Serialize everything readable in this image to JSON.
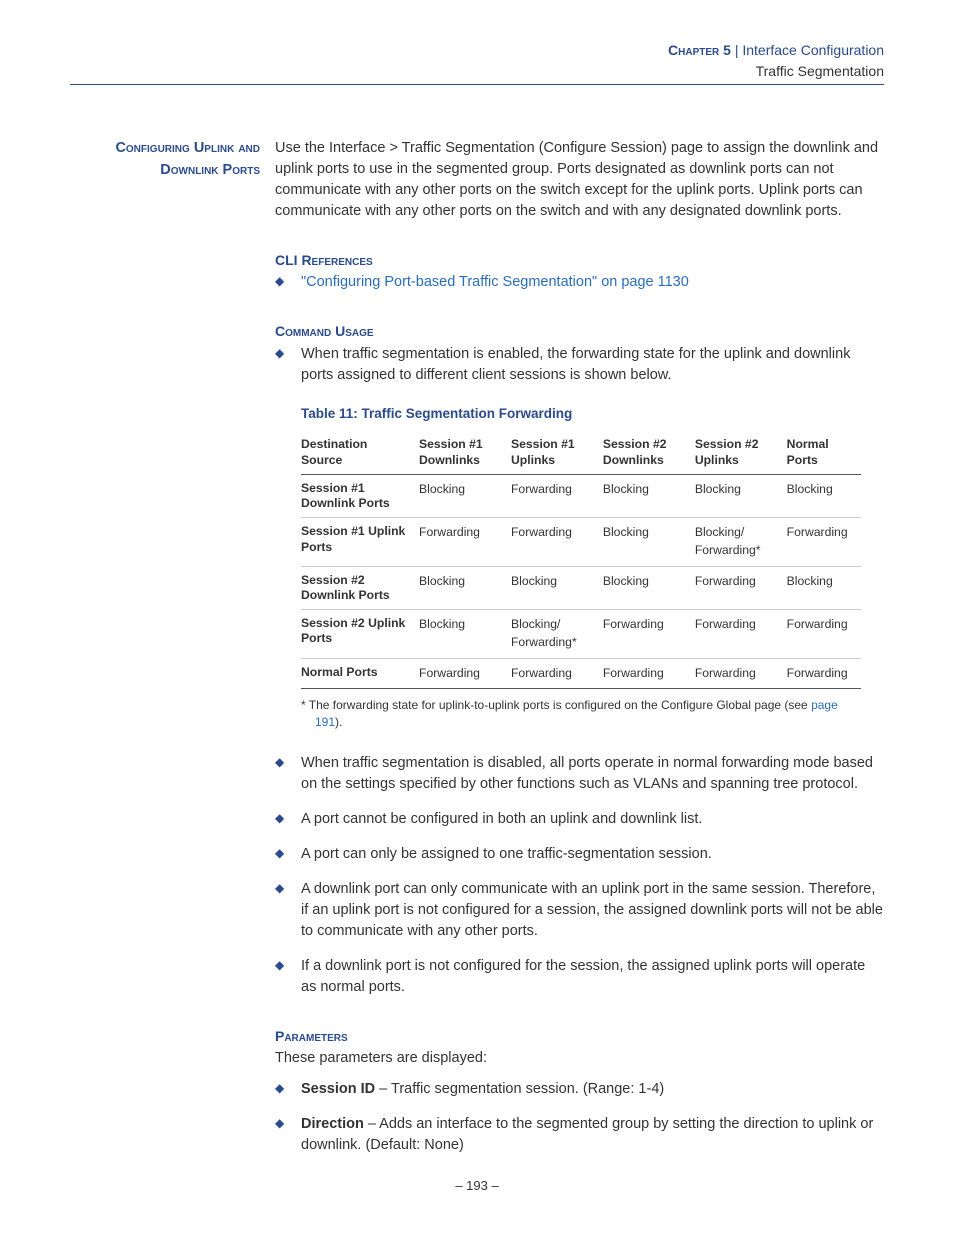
{
  "header": {
    "chapter_label": "Chapter 5",
    "separator": " | ",
    "chapter_title": "Interface Configuration",
    "section_title": "Traffic Segmentation"
  },
  "sidehead": "Configuring Uplink and Downlink Ports",
  "intro": "Use the Interface > Traffic Segmentation (Configure Session) page to assign the downlink and uplink ports to use in the segmented group. Ports designated as downlink ports can not communicate with any other ports on the switch except for the uplink ports. Uplink ports can communicate with any other ports on the switch and with any designated downlink ports.",
  "cli": {
    "heading": "CLI References",
    "link": "\"Configuring Port-based Traffic Segmentation\" on page 1130"
  },
  "usage": {
    "heading": "Command Usage",
    "bullets_pre": [
      "When traffic segmentation is enabled, the forwarding state for the uplink and downlink ports assigned to different client sessions is shown below."
    ],
    "table_title": "Table 11: Traffic Segmentation Forwarding",
    "table": {
      "corner_top": "Destination",
      "corner_bottom": "Source",
      "cols": [
        "Session #1 Downlinks",
        "Session #1 Uplinks",
        "Session #2 Downlinks",
        "Session #2 Uplinks",
        "Normal Ports"
      ],
      "rows": [
        {
          "h": "Session #1 Downlink Ports",
          "c": [
            "Blocking",
            "Forwarding",
            "Blocking",
            "Blocking",
            "Blocking"
          ]
        },
        {
          "h": "Session #1 Uplink Ports",
          "c": [
            "Forwarding",
            "Forwarding",
            "Blocking",
            "Blocking/ Forwarding*",
            "Forwarding"
          ]
        },
        {
          "h": "Session #2 Downlink Ports",
          "c": [
            "Blocking",
            "Blocking",
            "Blocking",
            "Forwarding",
            "Blocking"
          ]
        },
        {
          "h": "Session #2 Uplink Ports",
          "c": [
            "Blocking",
            "Blocking/ Forwarding*",
            "Forwarding",
            "Forwarding",
            "Forwarding"
          ]
        },
        {
          "h": "Normal Ports",
          "c": [
            "Forwarding",
            "Forwarding",
            "Forwarding",
            "Forwarding",
            "Forwarding"
          ]
        }
      ]
    },
    "footnote_prefix": "* The forwarding state for uplink-to-uplink ports is configured on the Configure Global page (see ",
    "footnote_link": "page 191",
    "footnote_suffix": ").",
    "bullets_post": [
      "When traffic segmentation is disabled, all ports operate in normal forwarding mode based on the settings specified by other functions such as VLANs and spanning tree protocol.",
      "A port cannot be configured in both an uplink and downlink list.",
      "A port can only be assigned to one traffic-segmentation session.",
      "A downlink port can only communicate with an uplink port in the same session. Therefore, if an uplink port is not configured for a session, the assigned downlink ports will not be able to communicate with any other ports.",
      "If a downlink port is not configured for the session, the assigned uplink ports will operate as normal ports."
    ]
  },
  "params": {
    "heading": "Parameters",
    "intro": "These parameters are displayed:",
    "items": [
      {
        "b": "Session ID",
        "t": " – Traffic segmentation session. (Range: 1-4)"
      },
      {
        "b": "Direction",
        "t": " – Adds an interface to the segmented group by setting the direction to uplink or downlink. (Default: None)"
      }
    ]
  },
  "pagenum": "– 193 –"
}
